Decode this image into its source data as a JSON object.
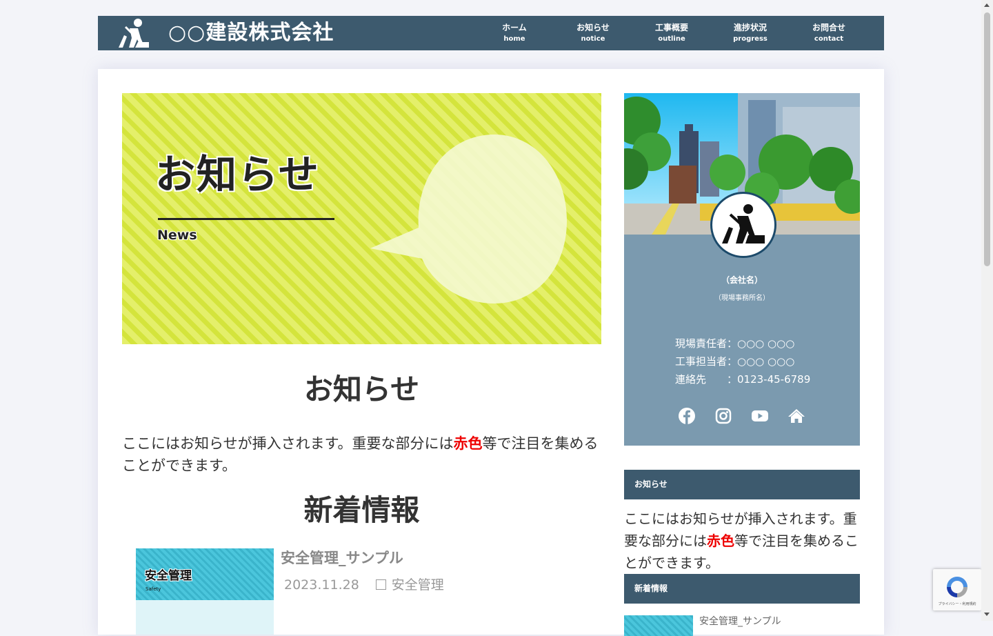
{
  "header": {
    "site_title": "○○建設株式会社",
    "nav": [
      {
        "jp": "ホーム",
        "en": "home"
      },
      {
        "jp": "お知らせ",
        "en": "notice"
      },
      {
        "jp": "工事概要",
        "en": "outline"
      },
      {
        "jp": "進捗状況",
        "en": "progress"
      },
      {
        "jp": "お問合せ",
        "en": "contact"
      }
    ]
  },
  "hero": {
    "title": "お知らせ",
    "subtitle": "News"
  },
  "main": {
    "notice_heading": "お知らせ",
    "notice_text_before": "ここにはお知らせが挿入されます。重要な部分には",
    "notice_text_red": "赤色",
    "notice_text_after": "等で注目を集めることができます。",
    "news_heading": "新着情報",
    "post": {
      "thumb_title": "安全管理",
      "thumb_subtitle": "Safety",
      "title": "安全管理_サンプル",
      "date": "2023.11.28",
      "category": "安全管理"
    }
  },
  "profile": {
    "company": "（会社名）",
    "office": "（現場事務所名）",
    "lines": [
      "現場責任者：○○○ ○○○",
      "工事担当者：○○○ ○○○",
      "連絡先　　：0123-45-6789"
    ],
    "social": [
      "facebook-icon",
      "instagram-icon",
      "youtube-icon",
      "home-icon"
    ]
  },
  "widgets": {
    "notice_title": "お知らせ",
    "notice_text_before": "ここにはお知らせが挿入されます。重要な部分には",
    "notice_text_red": "赤色",
    "notice_text_after": "等で注目を集めることができます。",
    "news_title": "新着情報",
    "news_post_title": "安全管理_サンプル"
  },
  "recaptcha": {
    "text": "プライバシー・利用規約"
  },
  "colors": {
    "header_bg": "#3d5a6e",
    "profile_bg": "#7b9aaf",
    "accent_red": "#ee0000",
    "hero_stripe": "#d4e43c"
  }
}
